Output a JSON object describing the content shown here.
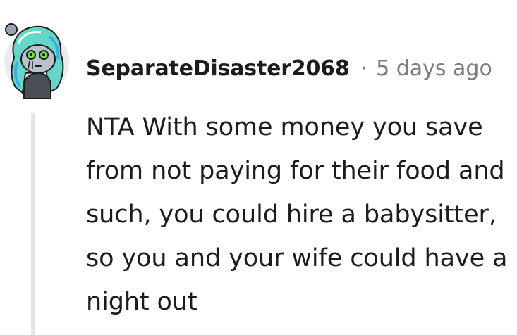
{
  "comment": {
    "avatar_icon": "user-avatar-icon",
    "username": "SeparateDisaster2068",
    "separator": "·",
    "timestamp": "5 days ago",
    "body": "NTA With some money you save from not paying for their food and such, you could hire a babysitter, so you and your wife could have a night out"
  }
}
